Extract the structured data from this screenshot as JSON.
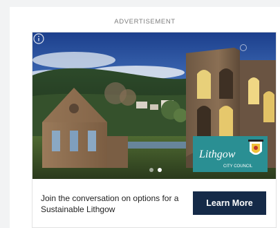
{
  "ad": {
    "header_label": "ADVERTISEMENT",
    "tagline": "Join the conversation on options for a Sustainable Lithgow",
    "cta_label": "Learn More",
    "carousel": {
      "total": 2,
      "active_index": 1
    },
    "logo": {
      "name": "Lithgow",
      "subtitle": "CITY COUNCIL"
    }
  },
  "colors": {
    "cta_background": "#152a48",
    "logo_background": "#2a8f93"
  },
  "icons": [
    "info-icon",
    "close-icon",
    "council-crest-icon"
  ]
}
